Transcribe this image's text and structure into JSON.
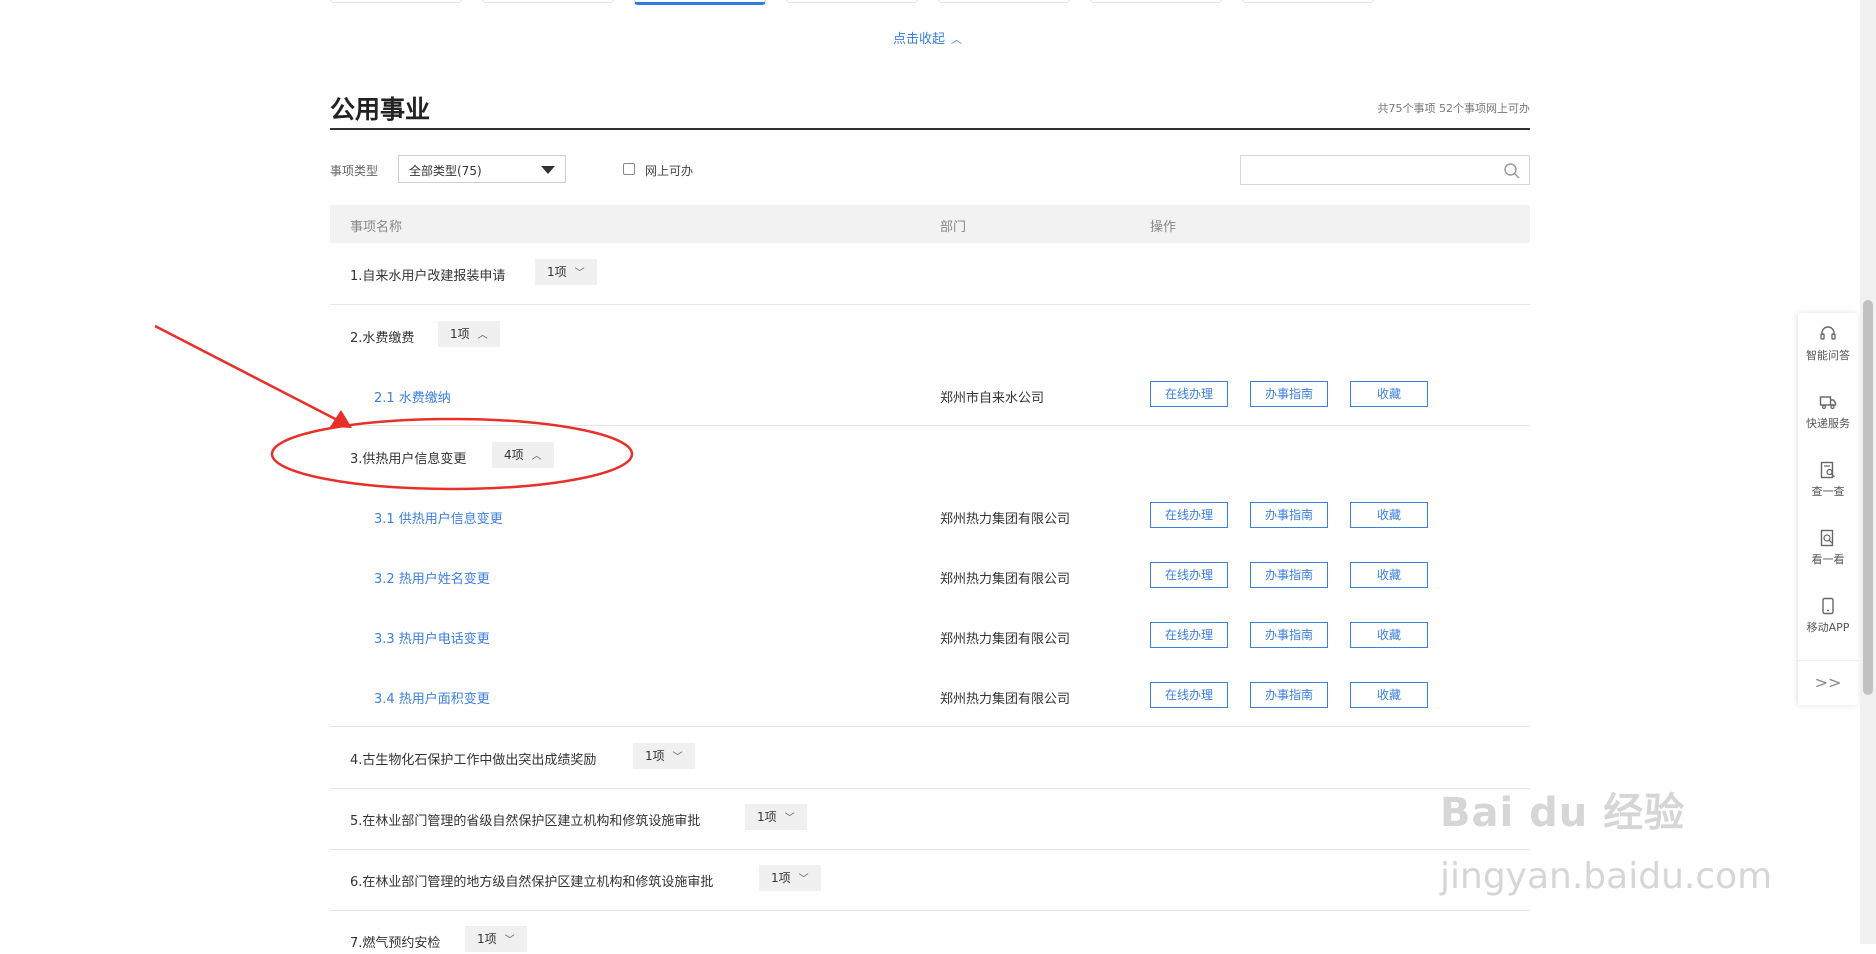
{
  "collapse": {
    "label": "点击收起",
    "chevron": "^"
  },
  "section": {
    "title": "公用事业",
    "summary": "共75个事项 52个事项网上可办"
  },
  "filters": {
    "type_label": "事项类型",
    "type_selected": "全部类型(75)",
    "online_label": "网上可办",
    "online_checked": false,
    "search_value": ""
  },
  "table": {
    "headers": {
      "name": "事项名称",
      "dept": "部门",
      "ops": "操作"
    }
  },
  "buttons": {
    "online": "在线办理",
    "guide": "办事指南",
    "favorite": "收藏"
  },
  "groups": [
    {
      "title": "1.自来水用户改建报装申请",
      "count": "1项",
      "expanded": false
    },
    {
      "title": "2.水费缴费",
      "count": "1项",
      "expanded": true,
      "items": [
        {
          "name": "2.1 水费缴纳",
          "dept": "郑州市自来水公司"
        }
      ]
    },
    {
      "title": "3.供热用户信息变更",
      "count": "4项",
      "expanded": true,
      "items": [
        {
          "name": "3.1 供热用户信息变更",
          "dept": "郑州热力集团有限公司"
        },
        {
          "name": "3.2 热用户姓名变更",
          "dept": "郑州热力集团有限公司"
        },
        {
          "name": "3.3 热用户电话变更",
          "dept": "郑州热力集团有限公司"
        },
        {
          "name": "3.4 热用户面积变更",
          "dept": "郑州热力集团有限公司"
        }
      ]
    },
    {
      "title": "4.古生物化石保护工作中做出突出成绩奖励",
      "count": "1项",
      "expanded": false
    },
    {
      "title": "5.在林业部门管理的省级自然保护区建立机构和修筑设施审批",
      "count": "1项",
      "expanded": false
    },
    {
      "title": "6.在林业部门管理的地方级自然保护区建立机构和修筑设施审批",
      "count": "1项",
      "expanded": false
    },
    {
      "title": "7.燃气预约安检",
      "count": "1项",
      "expanded": false
    }
  ],
  "side_panel": {
    "items": [
      {
        "label": "智能问答",
        "icon": "headset-icon"
      },
      {
        "label": "快递服务",
        "icon": "truck-icon"
      },
      {
        "label": "查一查",
        "icon": "doc-search-icon"
      },
      {
        "label": "看一看",
        "icon": "view-icon"
      },
      {
        "label": "移动APP",
        "icon": "phone-icon"
      }
    ],
    "expand": ">>"
  },
  "watermark": {
    "line1": "Bai du 经验",
    "line2": "jingyan.baidu.com"
  },
  "colors": {
    "accent": "#3b7fe0",
    "annotation": "#e8302a"
  }
}
